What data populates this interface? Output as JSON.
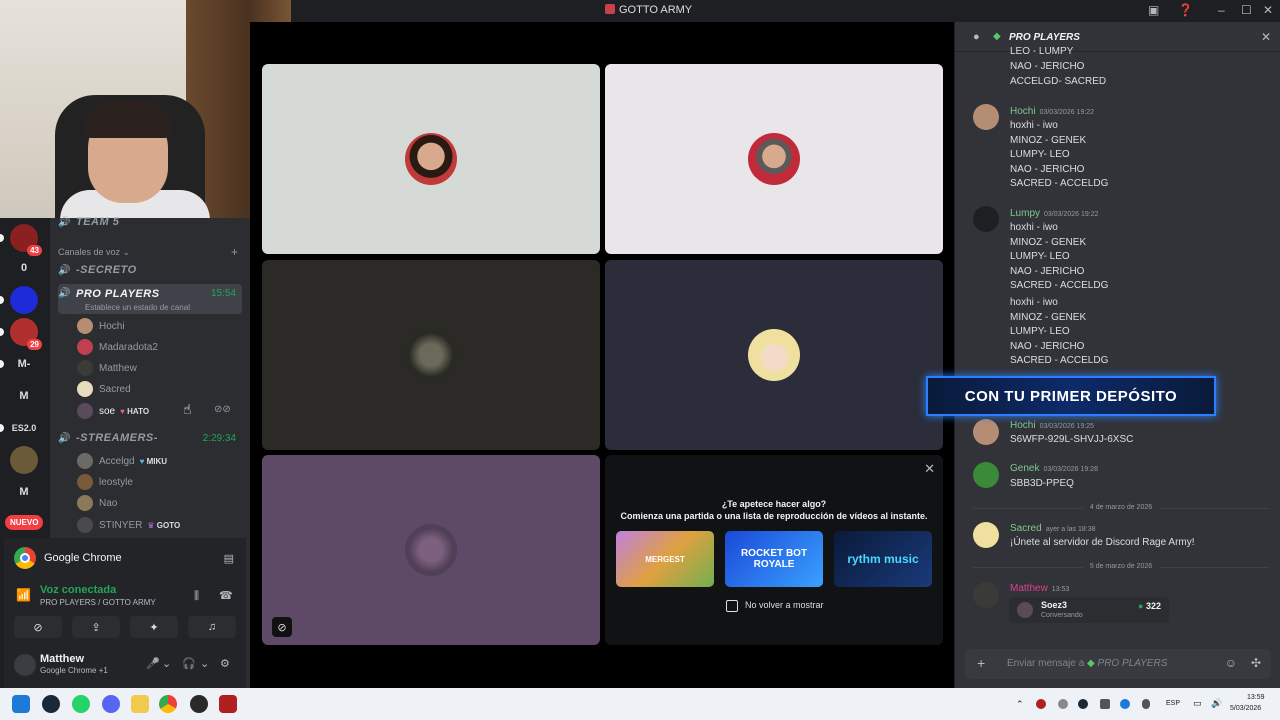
{
  "window": {
    "title": "GOTTO ARMY"
  },
  "rail": {
    "servers": [
      {
        "label": "",
        "badge": "43"
      },
      {
        "label": "0",
        "badge": ""
      },
      {
        "label": "",
        "badge": ""
      },
      {
        "label": "",
        "badge": "29"
      },
      {
        "label": "M-",
        "badge": ""
      },
      {
        "label": "M",
        "badge": ""
      },
      {
        "label": "ES2.0",
        "badge": ""
      },
      {
        "label": "",
        "badge": ""
      },
      {
        "label": "M",
        "badge": ""
      }
    ],
    "nuevo": "NUEVO"
  },
  "sidebar": {
    "top_channel": "TEAM 5",
    "section_label": "Canales de voz",
    "channels": [
      {
        "name": "-SECRETO",
        "timer": ""
      },
      {
        "name": "PRO PLAYERS",
        "timer": "15:54",
        "subtitle": "Establece un estado de canal"
      },
      {
        "name": "-STREAMERS-",
        "timer": "2:29:34"
      }
    ],
    "pro_members": [
      {
        "name": "Hochi",
        "tag": ""
      },
      {
        "name": "Madaradota2",
        "tag": ""
      },
      {
        "name": "Matthew",
        "tag": ""
      },
      {
        "name": "Sacred",
        "tag": ""
      },
      {
        "name": "soe",
        "tag": "HATO"
      }
    ],
    "streamer_members": [
      {
        "name": "Accelgd",
        "tag": "MIKU"
      },
      {
        "name": "leostyle",
        "tag": ""
      },
      {
        "name": "Nao",
        "tag": ""
      },
      {
        "name": "STINYER",
        "tag": "GOTO"
      }
    ]
  },
  "stream_bar": {
    "label": "Google Chrome"
  },
  "voice": {
    "status": "Voz conectada",
    "location": "PRO PLAYERS / GOTTO ARMY"
  },
  "user": {
    "name": "Matthew",
    "status": "Google Chrome +1"
  },
  "activity": {
    "question": "¿Te apetece hacer algo?",
    "description": "Comienza una partida o una lista de reproducción de vídeos al instante.",
    "cards": [
      "MERGEST",
      "ROCKET BOT ROYALE",
      "rythm music"
    ],
    "checkbox": "No volver a mostrar"
  },
  "chat": {
    "header": "PRO PLAYERS",
    "top_lines": [
      "LEO - LUMPY",
      "NAO - JERICHO",
      "ACCELGD- SACRED"
    ],
    "messages": [
      {
        "author": "Hochi",
        "time": "03/03/2026 19:22",
        "color": "#7ec98f",
        "lines": [
          "hoxhi - iwo",
          "MINOZ - GENEK",
          "LUMPY- LEO",
          "NAO - JERICHO",
          "SACRED - ACCELDG"
        ]
      },
      {
        "author": "Lumpy",
        "time": "03/03/2026 19:22",
        "color": "#7ec98f",
        "lines": [
          "hoxhi - iwo",
          "MINOZ - GENEK",
          "LUMPY- LEO",
          "NAO - JERICHO",
          "SACRED - ACCELDG",
          "hoxhi - iwo",
          "MINOZ - GENEK",
          "LUMPY- LEO",
          "NAO - JERICHO",
          "SACRED - ACCELDG"
        ]
      },
      {
        "author": "Hochi",
        "time": "03/03/2026 19:25",
        "color": "#7ec98f",
        "lines": [
          "S6WFP-929L-SHVJJ-6XSC"
        ]
      },
      {
        "author": "Genek",
        "time": "03/03/2026 19:28",
        "color": "#7ec98f",
        "lines": [
          "SBB3D-PPEQ"
        ]
      },
      {
        "author": "Sacred",
        "time": "ayer a las 18:38",
        "color": "#7ec98f",
        "lines": [
          "¡Únete al servidor de Discord Rage Army!"
        ]
      },
      {
        "author": "Matthew",
        "time": "13:53",
        "color": "#e0408a",
        "lines": []
      }
    ],
    "date_dividers": [
      "4 de marzo de 2026",
      "5 de marzo de 2026"
    ],
    "promo": "CON TU PRIMER DEPÓSITO",
    "invite": {
      "name": "Soez3",
      "status": "Conversando",
      "count": "322"
    },
    "input_placeholder": "Enviar mensaje a",
    "input_channel": "PRO PLAYERS"
  },
  "taskbar": {
    "lang": "ESP",
    "time": "13:59",
    "date": "5/03/2026"
  }
}
